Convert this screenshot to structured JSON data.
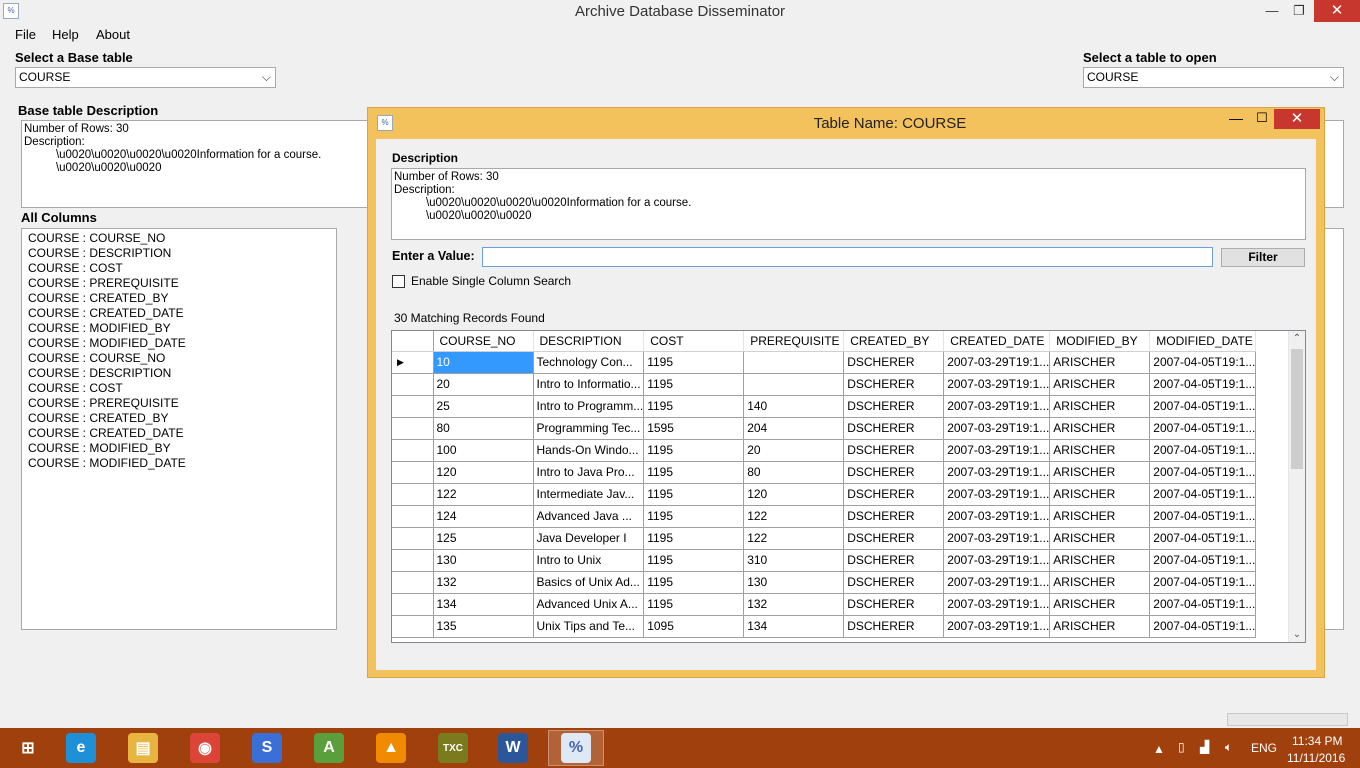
{
  "window": {
    "title": "Archive Database Disseminator",
    "min_glyph": "—",
    "max_glyph": "❐",
    "close_glyph": "✕",
    "icon_glyph": "%"
  },
  "menu": {
    "file": "File",
    "help": "Help",
    "about": "About"
  },
  "base_table": {
    "label": "Select a Base table",
    "selected": "COURSE"
  },
  "open_table": {
    "label": "Select a table to open",
    "selected": "COURSE"
  },
  "base_description": {
    "label": "Base table Description",
    "text": "Number of Rows: 30\nDescription:\n          \\u0020\\u0020\\u0020\\u0020Information for a course.\n          \\u0020\\u0020\\u0020"
  },
  "all_columns": {
    "label": "All Columns",
    "items": [
      "COURSE : COURSE_NO",
      "COURSE : DESCRIPTION",
      "COURSE : COST",
      "COURSE : PREREQUISITE",
      "COURSE : CREATED_BY",
      "COURSE : CREATED_DATE",
      "COURSE : MODIFIED_BY",
      "COURSE : MODIFIED_DATE",
      "COURSE : COURSE_NO",
      "COURSE : DESCRIPTION",
      "COURSE : COST",
      "COURSE : PREREQUISITE",
      "COURSE : CREATED_BY",
      "COURSE : CREATED_DATE",
      "COURSE : MODIFIED_BY",
      "COURSE : MODIFIED_DATE"
    ]
  },
  "child": {
    "title": "Table Name: COURSE",
    "min_glyph": "—",
    "max_glyph": "☐",
    "close_glyph": "✕",
    "description_label": "Description",
    "description_text": "Number of Rows: 30\nDescription:\n          \\u0020\\u0020\\u0020\\u0020Information for a course.\n          \\u0020\\u0020\\u0020",
    "enter_value_label": "Enter a Value:",
    "filter_value": "",
    "filter_button": "Filter",
    "single_column_label": "Enable Single Column Search",
    "single_column_checked": false,
    "records_found": "30 Matching Records Found"
  },
  "grid": {
    "current_row_marker": "▶",
    "columns": [
      "COURSE_NO",
      "DESCRIPTION",
      "COST",
      "PREREQUISITE",
      "CREATED_BY",
      "CREATED_DATE",
      "MODIFIED_BY",
      "MODIFIED_DATE"
    ],
    "rows": [
      [
        "10",
        "Technology Con...",
        "1195",
        "",
        "DSCHERER",
        "2007-03-29T19:1...",
        "ARISCHER",
        "2007-04-05T19:1..."
      ],
      [
        "20",
        "Intro to Informatio...",
        "1195",
        "",
        "DSCHERER",
        "2007-03-29T19:1...",
        "ARISCHER",
        "2007-04-05T19:1..."
      ],
      [
        "25",
        "Intro to Programm...",
        "1195",
        "140",
        "DSCHERER",
        "2007-03-29T19:1...",
        "ARISCHER",
        "2007-04-05T19:1..."
      ],
      [
        "80",
        "Programming Tec...",
        "1595",
        "204",
        "DSCHERER",
        "2007-03-29T19:1...",
        "ARISCHER",
        "2007-04-05T19:1..."
      ],
      [
        "100",
        "Hands-On Windo...",
        "1195",
        "20",
        "DSCHERER",
        "2007-03-29T19:1...",
        "ARISCHER",
        "2007-04-05T19:1..."
      ],
      [
        "120",
        "Intro to Java Pro...",
        "1195",
        "80",
        "DSCHERER",
        "2007-03-29T19:1...",
        "ARISCHER",
        "2007-04-05T19:1..."
      ],
      [
        "122",
        "Intermediate Jav...",
        "1195",
        "120",
        "DSCHERER",
        "2007-03-29T19:1...",
        "ARISCHER",
        "2007-04-05T19:1..."
      ],
      [
        "124",
        "Advanced Java ...",
        "1195",
        "122",
        "DSCHERER",
        "2007-03-29T19:1...",
        "ARISCHER",
        "2007-04-05T19:1..."
      ],
      [
        "125",
        "Java Developer I",
        "1195",
        "122",
        "DSCHERER",
        "2007-03-29T19:1...",
        "ARISCHER",
        "2007-04-05T19:1..."
      ],
      [
        "130",
        "Intro to Unix",
        "1195",
        "310",
        "DSCHERER",
        "2007-03-29T19:1...",
        "ARISCHER",
        "2007-04-05T19:1..."
      ],
      [
        "132",
        "Basics of Unix Ad...",
        "1195",
        "130",
        "DSCHERER",
        "2007-03-29T19:1...",
        "ARISCHER",
        "2007-04-05T19:1..."
      ],
      [
        "134",
        "Advanced Unix A...",
        "1195",
        "132",
        "DSCHERER",
        "2007-03-29T19:1...",
        "ARISCHER",
        "2007-04-05T19:1..."
      ],
      [
        "135",
        "Unix Tips and Te...",
        "1095",
        "134",
        "DSCHERER",
        "2007-03-29T19:1...",
        "ARISCHER",
        "2007-04-05T19:1..."
      ]
    ]
  },
  "taskbar": {
    "apps": [
      {
        "name": "windows-start-icon",
        "glyph": "⊞",
        "color": "#a0400c"
      },
      {
        "name": "internet-explorer-icon",
        "glyph": "e",
        "color": "#1e90d8"
      },
      {
        "name": "file-explorer-icon",
        "glyph": "▤",
        "color": "#e8b640"
      },
      {
        "name": "chrome-icon",
        "glyph": "◉",
        "color": "#db4437"
      },
      {
        "name": "swirl-app-icon",
        "glyph": "S",
        "color": "#3a6fd8"
      },
      {
        "name": "android-studio-icon",
        "glyph": "A",
        "color": "#5b9e3c"
      },
      {
        "name": "vlc-icon",
        "glyph": "▲",
        "color": "#f08a00"
      },
      {
        "name": "texmaker-icon",
        "glyph": "TXC",
        "color": "#7a7a1e"
      },
      {
        "name": "word-icon",
        "glyph": "W",
        "color": "#2b579a"
      },
      {
        "name": "archive-disseminator-icon",
        "glyph": "%",
        "color": "#dfe8f5"
      }
    ],
    "language": "ENG",
    "time": "11:34 PM",
    "date": "11/11/2016"
  },
  "colors": {
    "child_frame": "#f3c25d",
    "taskbar": "#a0400c",
    "selection": "#3399ff",
    "close_button": "#c7372e"
  }
}
